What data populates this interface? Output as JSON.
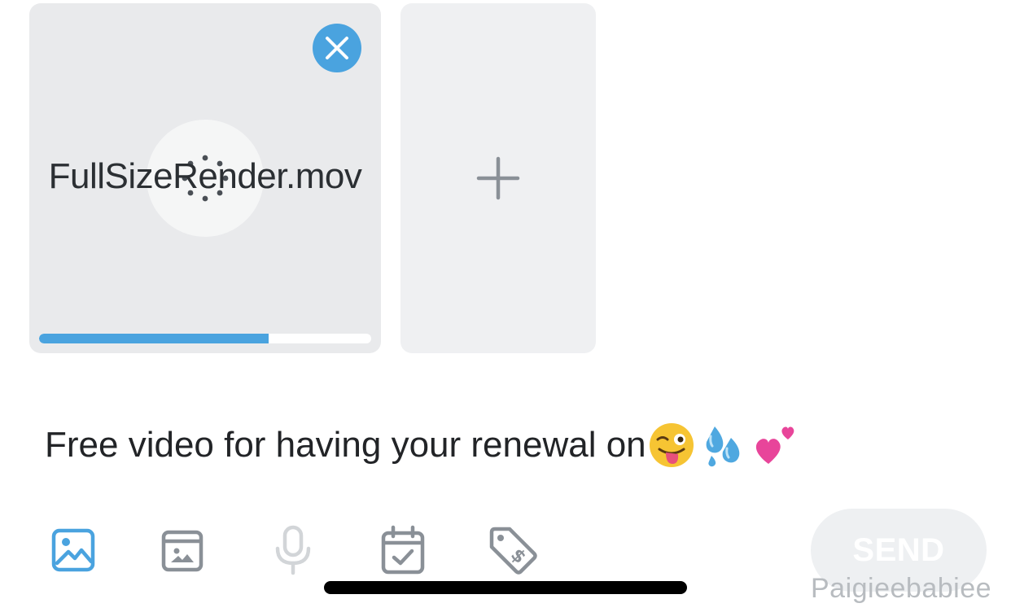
{
  "media": {
    "file_name": "FullSizeRender.mov",
    "upload_progress": 0.69,
    "remove_icon": "close-icon",
    "loading_icon": "spinner-icon",
    "add_icon": "plus-icon"
  },
  "caption": {
    "text": "Free video for having your renewal on",
    "emojis": [
      "winking-face-with-tongue",
      "sweat-droplets",
      "two-hearts"
    ]
  },
  "toolbar": {
    "icons": [
      "image-icon",
      "vault-icon",
      "microphone-icon",
      "calendar-check-icon",
      "price-tag-icon"
    ],
    "send_label": "SEND"
  },
  "watermark": "Paigieebabiee",
  "colors": {
    "accent": "#4aa3df",
    "icon_gray": "#8a9097",
    "icon_disabled": "#d2d5d8"
  }
}
